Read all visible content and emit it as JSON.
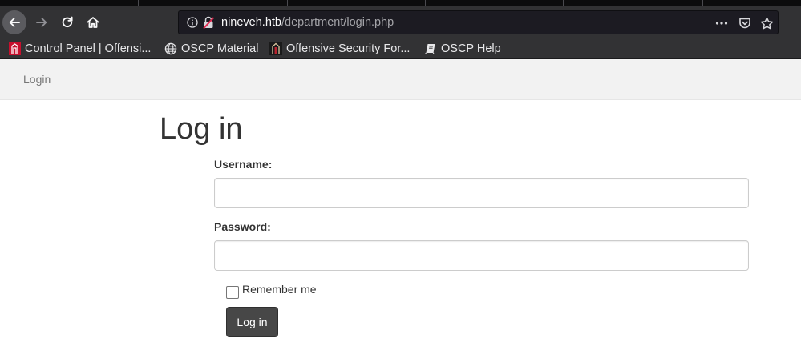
{
  "browser": {
    "url_host": "nineveh.htb",
    "url_path": "/department/login.php",
    "bookmarks": [
      {
        "label": "Control Panel | Offensi...",
        "icon": "offsec-logo-icon"
      },
      {
        "label": "OSCP Material",
        "icon": "globe-icon"
      },
      {
        "label": "Offensive Security For...",
        "icon": "offsec-forum-icon"
      },
      {
        "label": "OSCP Help",
        "icon": "book-icon"
      }
    ]
  },
  "page": {
    "nav_link": "Login",
    "title": "Log in",
    "form": {
      "username_label": "Username:",
      "username_value": "",
      "password_label": "Password:",
      "password_value": "",
      "remember_label": "Remember me",
      "remember_checked": false,
      "submit_label": "Log in"
    }
  },
  "colors": {
    "chrome_bg": "#323234",
    "urlbar_bg": "#1c1b22",
    "nav_bg": "#f2f2f2",
    "button_bg": "#474747",
    "text": "#333333"
  }
}
